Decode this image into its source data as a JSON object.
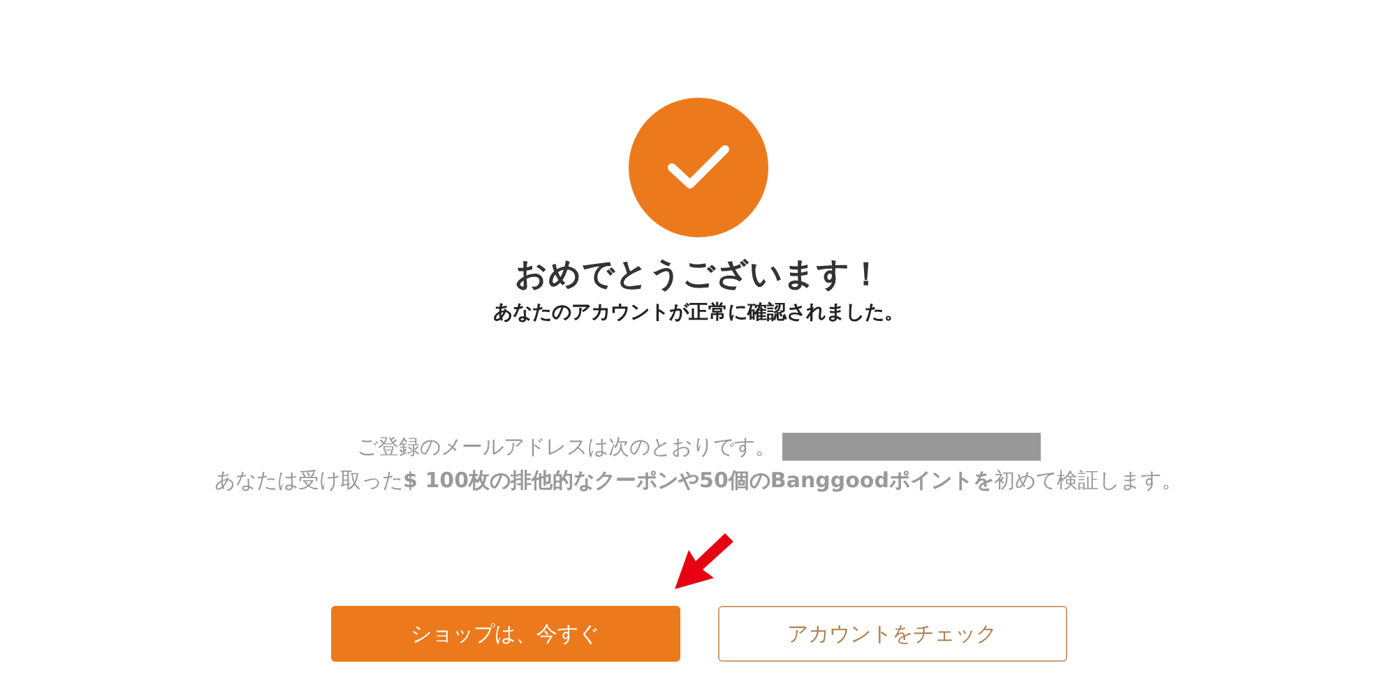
{
  "heading": "おめでとうございます！",
  "subheading": "あなたのアカウントが正常に確認されました。",
  "info_lines": [
    "ご登録のメールアドレスは次のとおりです。",
    "あなたは受け取った**$ 100枚の排他的なクーポンや50個のBanggoodポイントを**初めて検証します。"
  ],
  "buttons": [
    {
      "label": "ショップは、今すぐ",
      "kind": "primary"
    },
    {
      "label": "アカウントをチェック",
      "kind": "outline"
    }
  ]
}
